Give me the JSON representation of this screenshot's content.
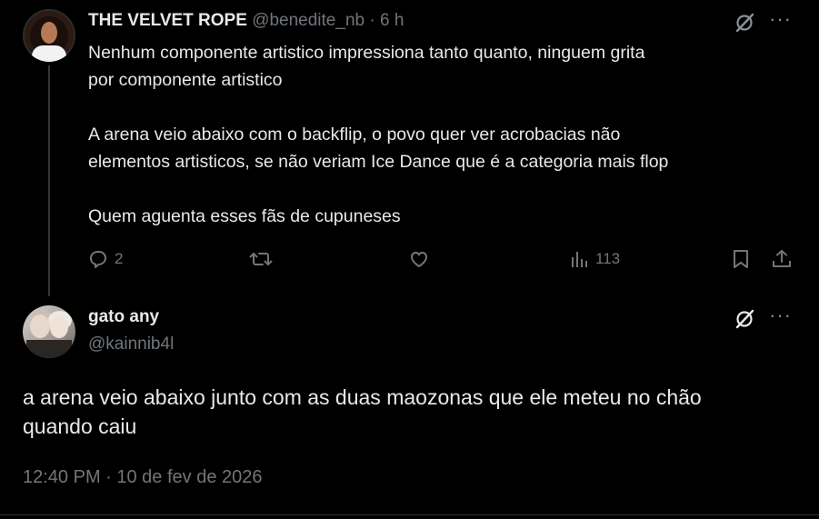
{
  "tweet1": {
    "display_name": "THE VELVET ROPE",
    "handle": "@benedite_nb",
    "separator": "·",
    "time_ago": "6 h",
    "text": "Nenhum componente artistico impressiona tanto quanto, ninguem grita\npor componente artistico\n\nA arena veio abaixo com o backflip, o povo quer ver acrobacias não\nelementos artisticos, se não veriam Ice Dance que é a categoria mais flop\n\nQuem aguenta esses fãs de cupuneses",
    "reply_count": "2",
    "views_count": "113",
    "more_glyph": "···"
  },
  "tweet2": {
    "display_name": "gato any",
    "handle": "@kainnib4l",
    "text": "a arena veio abaixo junto com as duas maozonas que ele meteu no chão\nquando caiu",
    "timestamp": "12:40 PM · 10 de fev de 2026",
    "more_glyph": "···"
  },
  "colors": {
    "background": "#000000",
    "text": "#e7e9ea",
    "muted": "#71767b",
    "divider": "#2f3336"
  },
  "icons": [
    "grok-icon",
    "more-icon",
    "reply-icon",
    "retweet-icon",
    "like-icon",
    "views-icon",
    "bookmark-icon",
    "share-icon"
  ]
}
